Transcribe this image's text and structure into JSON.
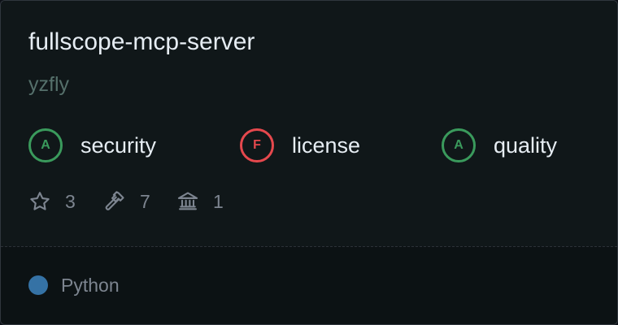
{
  "repo": {
    "name": "fullscope-mcp-server",
    "owner": "yzfly"
  },
  "scores": [
    {
      "grade": "A",
      "label": "security",
      "status": "pass",
      "color": "#3a9a5c"
    },
    {
      "grade": "F",
      "label": "license",
      "status": "fail",
      "color": "#e5484d"
    },
    {
      "grade": "A",
      "label": "quality",
      "status": "pass",
      "color": "#3a9a5c"
    }
  ],
  "stats": [
    {
      "icon": "star-icon",
      "value": "3"
    },
    {
      "icon": "hammer-icon",
      "value": "7"
    },
    {
      "icon": "bank-icon",
      "value": "1"
    }
  ],
  "language": {
    "name": "Python",
    "color": "#3572a5"
  }
}
